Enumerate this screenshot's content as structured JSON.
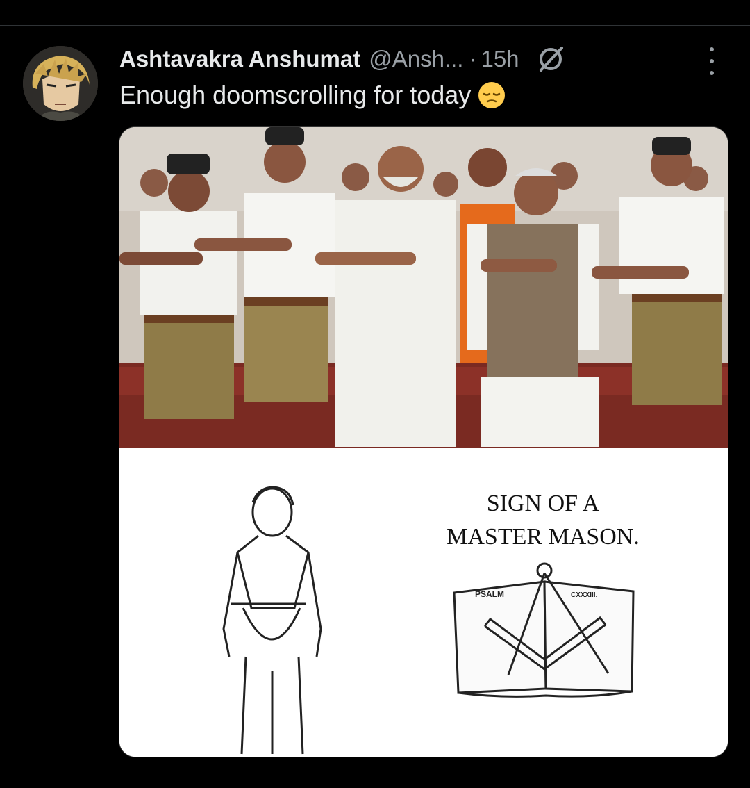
{
  "post": {
    "author_name": "Ashtavakra Anshumat",
    "handle": "@Ansh...",
    "separator": "·",
    "time": "15h",
    "text": "Enough doomscrolling for today",
    "emoji_icon": "pensive-face-emoji",
    "grok_icon": "grok-icon",
    "more_icon": "more-options-icon"
  },
  "meme": {
    "sign_line1": "SIGN OF A",
    "sign_line2": "MASTER MASON.",
    "book_left": "PSALM",
    "book_right": "CXXXIII."
  },
  "colors": {
    "background": "#000000",
    "text": "#e7e9ea",
    "secondary": "#9aa0a6"
  }
}
